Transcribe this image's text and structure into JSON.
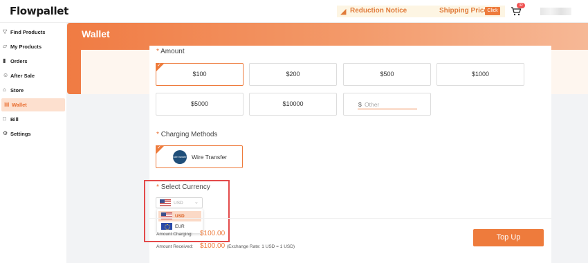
{
  "app": {
    "logo": "Flowpallet"
  },
  "topbar": {
    "notice_label": "Reduction Notice",
    "shipping_label": "Shipping Price",
    "click_label": "Click",
    "cart_count": "32"
  },
  "sidebar": {
    "items": [
      {
        "label": "Find Products",
        "icon": "filter-icon"
      },
      {
        "label": "My Products",
        "icon": "bag-icon"
      },
      {
        "label": "Orders",
        "icon": "chart-icon"
      },
      {
        "label": "After Sale",
        "icon": "person-icon"
      },
      {
        "label": "Store",
        "icon": "store-icon"
      },
      {
        "label": "Wallet",
        "icon": "wallet-icon",
        "active": true
      },
      {
        "label": "Bill",
        "icon": "document-icon"
      },
      {
        "label": "Settings",
        "icon": "gear-icon"
      }
    ]
  },
  "page": {
    "title": "Wallet"
  },
  "amount": {
    "label": "Amount",
    "required_mark": "*",
    "options": [
      "$100",
      "$200",
      "$500",
      "$1000",
      "$5000",
      "$10000"
    ],
    "selected": "$100",
    "other_prefix": "$",
    "other_placeholder": "Other"
  },
  "charging": {
    "label": "Charging Methods",
    "required_mark": "*",
    "method_label": "Wire Transfer",
    "method_logo_text": "wire transfer"
  },
  "currency": {
    "label": "Select Currency",
    "required_mark": "*",
    "selected": "USD",
    "options": [
      "USD",
      "EUR"
    ]
  },
  "summary": {
    "charging_label": "Amount Charging:",
    "charging_value": "$100.00",
    "received_label": "Amount Received:",
    "received_value": "$100.00",
    "rate_text": "(Exchange Rate: 1 USD = 1 USD)",
    "topup_label": "Top Up"
  },
  "colors": {
    "accent": "#ee7b3c",
    "highlight_box": "#e34a4a"
  }
}
